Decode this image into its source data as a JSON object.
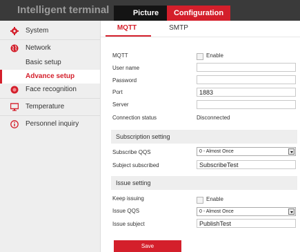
{
  "app": {
    "title": "Intelligent terminal"
  },
  "top_tabs": [
    {
      "label": "Picture"
    },
    {
      "label": "Configuration"
    }
  ],
  "sidebar": {
    "items": [
      {
        "label": "System",
        "icon": "gear-icon"
      },
      {
        "label": "Network",
        "icon": "globe-icon"
      },
      {
        "label": "Face recognition",
        "icon": "face-icon"
      },
      {
        "label": "Temperature",
        "icon": "monitor-icon"
      },
      {
        "label": "Personnel inquiry",
        "icon": "info-icon"
      }
    ],
    "network_subitems": [
      {
        "label": "Basic setup"
      },
      {
        "label": "Advance setup"
      }
    ],
    "accent_color": "#d41f2b"
  },
  "tabs": [
    {
      "label": "MQTT"
    },
    {
      "label": "SMTP"
    }
  ],
  "form": {
    "mqtt_label": "MQTT",
    "enable_label": "Enable",
    "username_label": "User name",
    "username_value": "",
    "password_label": "Password",
    "password_value": "",
    "port_label": "Port",
    "port_value": "1883",
    "server_label": "Server",
    "server_value": "",
    "status_label": "Connection status",
    "status_value": "Disconnected"
  },
  "subscription": {
    "title": "Subscription setting",
    "qos_label": "Subscribe QQS",
    "qos_value": "0 - Almost Once",
    "subject_label": "Subject subscribed",
    "subject_value": "SubscribeTest"
  },
  "issue": {
    "title": "Issue setting",
    "keep_label": "Keep issuing",
    "keep_enable_label": "Enable",
    "qos_label": "Issue QQS",
    "qos_value": "0 - Almost Once",
    "subject_label": "Issue subject",
    "subject_value": "PublishTest"
  },
  "save_label": "Save"
}
